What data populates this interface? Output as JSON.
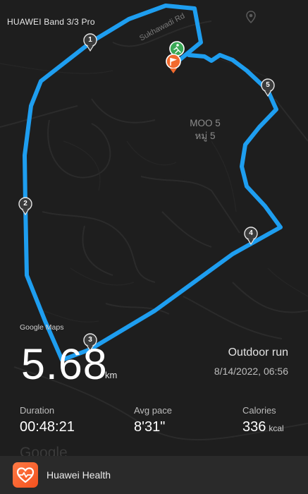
{
  "device_label": "HUAWEI Band 3/3 Pro",
  "map": {
    "street_label": "Sukhawadi Rd",
    "area_label_en": "MOO 5",
    "area_label_th": "หมู่ 5",
    "attribution": "Google Maps",
    "watermark": "Google",
    "route_color": "#1e9ef0",
    "km_markers": [
      "1",
      "2",
      "3",
      "4",
      "5"
    ]
  },
  "workout": {
    "distance": "5.68",
    "distance_unit": "km",
    "type": "Outdoor run",
    "datetime": "8/14/2022, 06:56"
  },
  "stats": [
    {
      "label": "Duration",
      "value": "00:48:21",
      "unit": ""
    },
    {
      "label": "Avg pace",
      "value": "8'31\"",
      "unit": ""
    },
    {
      "label": "Calories",
      "value": "336",
      "unit": "kcal"
    }
  ],
  "app_bar": {
    "app_name": "Huawei Health",
    "icon": "huawei-health-heart-icon",
    "accent": "#f4511e"
  }
}
